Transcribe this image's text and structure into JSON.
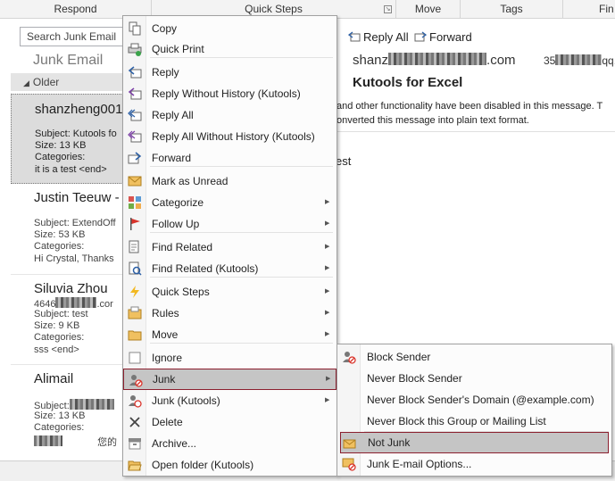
{
  "ribbon": {
    "groups": [
      "Respond",
      "Quick Steps",
      "Move",
      "Tags",
      "Fin"
    ]
  },
  "mail_list": {
    "search_placeholder": "Search Junk Email",
    "folder_title": "Junk Email",
    "group_header": "Older",
    "items": [
      {
        "sender": "shanzheng001(",
        "subject": "Subject: Kutools fo",
        "size": "Size: 13 KB",
        "categories": "Categories:",
        "preview": "it is a test  <end>"
      },
      {
        "sender": "Justin Teeuw -",
        "subject": "Subject: ExtendOff",
        "size": "Size: 53 KB",
        "categories": "Categories:",
        "preview": "Hi Crystal,  Thanks"
      },
      {
        "sender": "Siluvia Zhou",
        "extra": "4646",
        "extra_suffix": ".cor",
        "subject": "Subject: test",
        "size": "Size: 9 KB",
        "categories": "Categories:",
        "preview": "sss <end>"
      },
      {
        "sender": "Alimail",
        "subject": "Subject:",
        "size": "Size: 13 KB",
        "categories": "Categories:",
        "preview": "您的"
      }
    ]
  },
  "reading_pane": {
    "reply_all_label": "Reply All",
    "forward_label": "Forward",
    "from_prefix": "shanz",
    "from_suffix": ".com",
    "to_prefix": "35",
    "to_suffix": "qq.",
    "subject": "Kutools for Excel",
    "info_line1": "and other functionality have been disabled in this message. T",
    "info_line2": "onverted this message into plain text format.",
    "body": "est"
  },
  "context_menu": {
    "items": [
      {
        "label": "Copy",
        "icon": "copy-icon"
      },
      {
        "label": "Quick Print",
        "icon": "print-icon"
      },
      {
        "label": "Reply",
        "icon": "reply-icon"
      },
      {
        "label": "Reply Without History (Kutools)",
        "icon": "reply-kutools-icon"
      },
      {
        "label": "Reply All",
        "icon": "reply-all-icon"
      },
      {
        "label": "Reply All Without History (Kutools)",
        "icon": "reply-all-kutools-icon"
      },
      {
        "label": "Forward",
        "icon": "forward-icon"
      },
      {
        "label": "Mark as Unread",
        "icon": "envelope-icon"
      },
      {
        "label": "Categorize",
        "icon": "categorize-icon"
      },
      {
        "label": "Follow Up",
        "icon": "flag-icon"
      },
      {
        "label": "Find Related",
        "icon": "find-related-icon"
      },
      {
        "label": "Find Related (Kutools)",
        "icon": "find-related-kutools-icon"
      },
      {
        "label": "Quick Steps",
        "icon": "lightning-icon"
      },
      {
        "label": "Rules",
        "icon": "rules-icon"
      },
      {
        "label": "Move",
        "icon": "move-icon"
      },
      {
        "label": "Ignore",
        "icon": "ignore-icon"
      },
      {
        "label": "Junk",
        "icon": "junk-icon"
      },
      {
        "label": "Junk (Kutools)",
        "icon": "junk-kutools-icon"
      },
      {
        "label": "Delete",
        "icon": "delete-icon"
      },
      {
        "label": "Archive...",
        "icon": "archive-icon"
      },
      {
        "label": "Open folder (Kutools)",
        "icon": "open-folder-icon"
      }
    ]
  },
  "junk_submenu": {
    "items": [
      {
        "label": "Block Sender",
        "icon": "block-sender-icon"
      },
      {
        "label": "Never Block Sender",
        "icon": ""
      },
      {
        "label": "Never Block Sender's Domain (@example.com)",
        "icon": ""
      },
      {
        "label": "Never Block this Group or Mailing List",
        "icon": ""
      },
      {
        "label": "Not Junk",
        "icon": "not-junk-icon"
      },
      {
        "label": "Junk E-mail Options...",
        "icon": "junk-options-icon"
      }
    ]
  },
  "colors": {
    "highlight_border": "#8b1f2e",
    "highlight_fill": "#c5c5c5",
    "selected_mail_fill": "#dcdcdc"
  }
}
